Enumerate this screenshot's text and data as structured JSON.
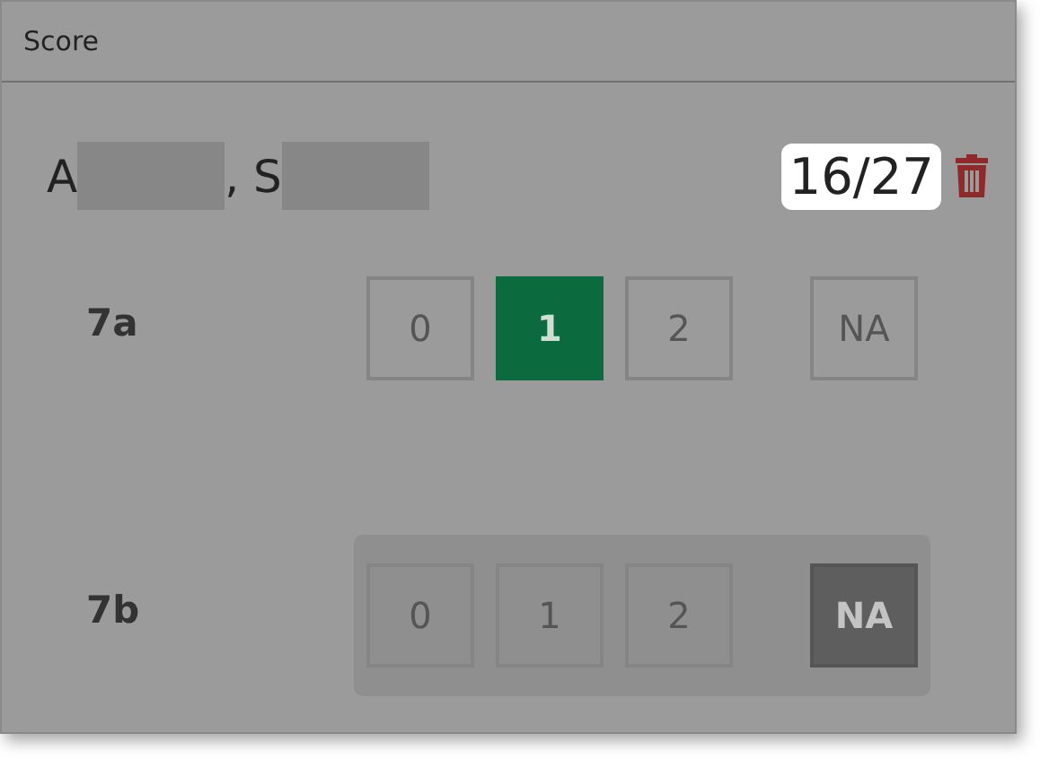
{
  "window": {
    "title": "Score"
  },
  "student": {
    "name_parts": [
      {
        "text": "A"
      },
      {
        "text": ", S"
      }
    ],
    "score": "16/27"
  },
  "items": [
    {
      "label": "7a",
      "highlighted": false,
      "options": [
        {
          "label": "0",
          "kind": "number",
          "selected": false
        },
        {
          "label": "1",
          "kind": "number",
          "selected": true
        },
        {
          "label": "2",
          "kind": "number",
          "selected": false
        },
        {
          "label": "NA",
          "kind": "na",
          "selected": false
        }
      ]
    },
    {
      "label": "7b",
      "highlighted": true,
      "options": [
        {
          "label": "0",
          "kind": "number",
          "selected": false
        },
        {
          "label": "1",
          "kind": "number",
          "selected": false
        },
        {
          "label": "2",
          "kind": "number",
          "selected": false
        },
        {
          "label": "NA",
          "kind": "na",
          "selected": true
        }
      ]
    }
  ]
}
